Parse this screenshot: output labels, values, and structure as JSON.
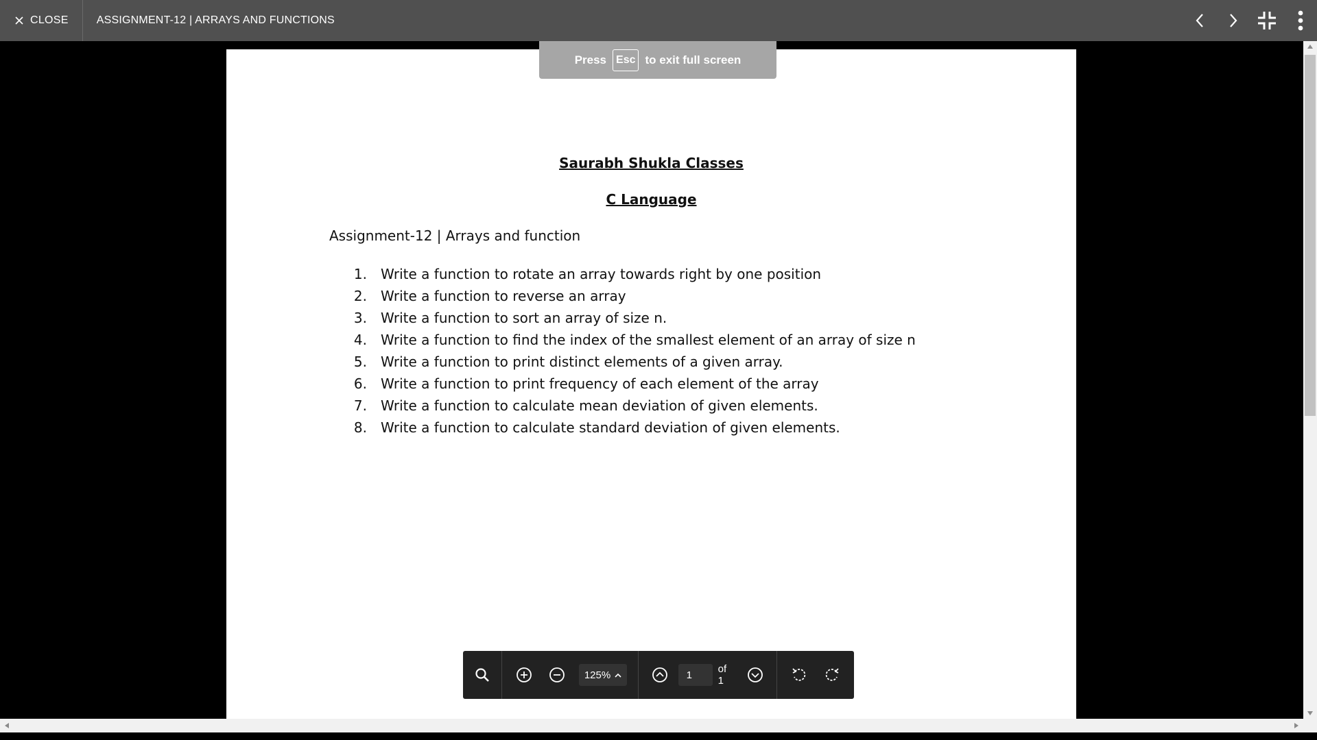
{
  "topbar": {
    "close_label": "CLOSE",
    "document_title": "ASSIGNMENT-12 | ARRAYS AND FUNCTIONS",
    "icons": [
      "close-icon",
      "chevron-left-icon",
      "chevron-right-icon",
      "exit-fullscreen-icon",
      "more-vert-icon"
    ]
  },
  "fullscreen_hint": {
    "prefix": "Press",
    "key": "Esc",
    "suffix": "to exit full screen"
  },
  "document": {
    "heading1": "Saurabh Shukla Classes",
    "heading2": "C Language",
    "assignment_line": "Assignment-12 | Arrays and function",
    "questions": [
      {
        "num": "1.",
        "text": "Write a function to rotate an array towards right by one position"
      },
      {
        "num": "2.",
        "text": "Write a function to reverse an array"
      },
      {
        "num": "3.",
        "text": "Write a function to sort an array of size n."
      },
      {
        "num": "4.",
        "text": "Write a function to find the index of the smallest element of an array of size n"
      },
      {
        "num": "5.",
        "text": "Write a function to print distinct elements of a given array."
      },
      {
        "num": "6.",
        "text": "Write a function to print frequency of each element of the array"
      },
      {
        "num": "7.",
        "text": "Write a function to calculate mean deviation of given elements."
      },
      {
        "num": "8.",
        "text": "Write a function to calculate standard deviation of given elements."
      }
    ]
  },
  "toolbar": {
    "zoom": "125%",
    "page_value": "1",
    "page_of": "of 1",
    "icons": [
      "search-icon",
      "zoom-in-icon",
      "zoom-out-icon",
      "chevron-up-icon",
      "page-up-icon",
      "page-down-icon",
      "rotate-left-icon",
      "rotate-right-icon"
    ]
  },
  "colors": {
    "topbar_bg": "#505050",
    "viewer_bg": "#000000",
    "toolbar_bg": "#222222",
    "hint_bg": "#a6a6a6"
  }
}
